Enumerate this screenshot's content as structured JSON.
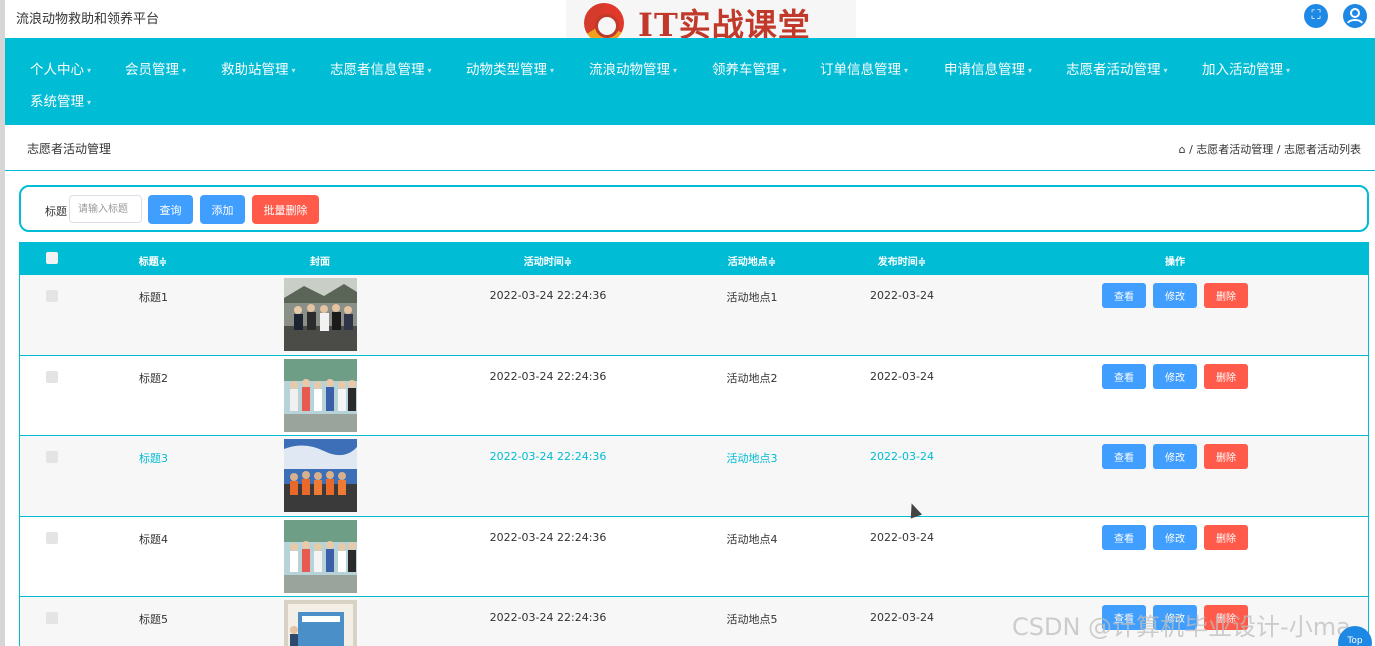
{
  "app": {
    "title": "流浪动物救助和领养平台",
    "logo_text": "IT实战课堂"
  },
  "header_icons": [
    {
      "name": "fullscreen-icon",
      "glyph": "⛶"
    },
    {
      "name": "user-icon",
      "glyph": "👤"
    }
  ],
  "nav": {
    "items": [
      {
        "label": "个人中心"
      },
      {
        "label": "会员管理"
      },
      {
        "label": "救助站管理"
      },
      {
        "label": "志愿者信息管理"
      },
      {
        "label": "动物类型管理"
      },
      {
        "label": "流浪动物管理"
      },
      {
        "label": "领养车管理"
      },
      {
        "label": "订单信息管理"
      },
      {
        "label": "申请信息管理"
      },
      {
        "label": "志愿者活动管理"
      },
      {
        "label": "加入活动管理"
      },
      {
        "label": "系统管理"
      }
    ],
    "caret": "▾"
  },
  "breadcrumb": {
    "page_title": "志愿者活动管理",
    "home_icon": "⌂",
    "path": "/ 志愿者活动管理 / 志愿者活动列表"
  },
  "search": {
    "label": "标题",
    "placeholder": "请输入标题",
    "query_label": "查询",
    "add_label": "添加",
    "batch_delete_label": "批量删除"
  },
  "table": {
    "headers": {
      "title": "标题≑",
      "cover": "封面",
      "time": "活动时间≑",
      "place": "活动地点≑",
      "publish": "发布时间≑",
      "actions": "操作"
    },
    "rows": [
      {
        "title": "标题1",
        "time": "2022-03-24 22:24:36",
        "place": "活动地点1",
        "publish": "2022-03-24",
        "view": "查看",
        "edit": "修改",
        "del": "删除"
      },
      {
        "title": "标题2",
        "time": "2022-03-24 22:24:36",
        "place": "活动地点2",
        "publish": "2022-03-24",
        "view": "查看",
        "edit": "修改",
        "del": "删除"
      },
      {
        "title": "标题3",
        "time": "2022-03-24 22:24:36",
        "place": "活动地点3",
        "publish": "2022-03-24",
        "view": "查看",
        "edit": "修改",
        "del": "删除"
      },
      {
        "title": "标题4",
        "time": "2022-03-24 22:24:36",
        "place": "活动地点4",
        "publish": "2022-03-24",
        "view": "查看",
        "edit": "修改",
        "del": "删除"
      },
      {
        "title": "标题5",
        "time": "2022-03-24 22:24:36",
        "place": "活动地点5",
        "publish": "2022-03-24",
        "view": "查看",
        "edit": "修改",
        "del": "删除"
      }
    ]
  },
  "watermark": "CSDN @计算机毕业设计-小ma",
  "top_button": "Top",
  "colors": {
    "primary": "#00bcd4",
    "button_blue": "#409eff",
    "button_red": "#ff5a4a"
  }
}
